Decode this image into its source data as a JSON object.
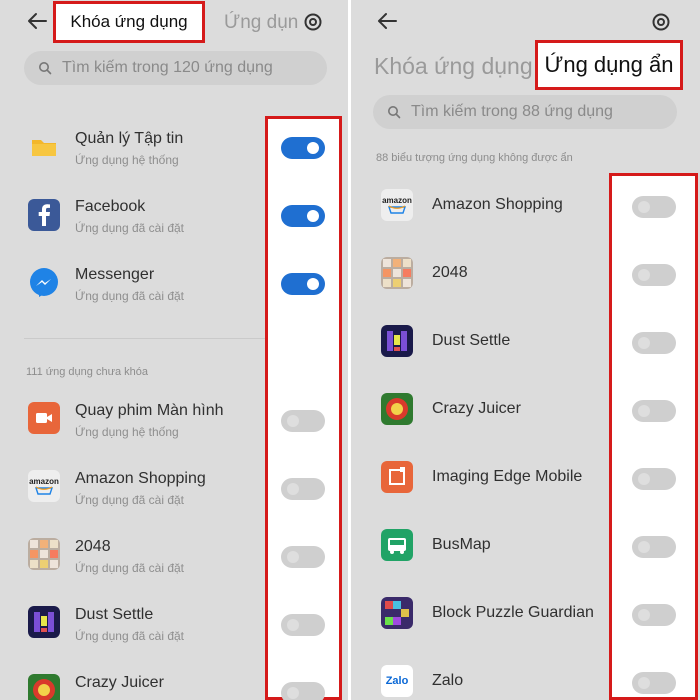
{
  "colors": {
    "accent": "#1f6fd1",
    "highlight": "#d51a1a",
    "background": "#dcdcdc"
  },
  "left": {
    "tab_active": "Khóa ứng dụng",
    "tab_inactive": "Ứng dụn",
    "search_placeholder": "Tìm kiếm trong 120 ứng dụng",
    "section_label": "111 ứng dụng chưa khóa",
    "locked": [
      {
        "name": "Quản lý Tập tin",
        "sub": "Ứng dụng hệ thống",
        "icon": "folder-icon",
        "on": true
      },
      {
        "name": "Facebook",
        "sub": "Ứng dụng đã cài đặt",
        "icon": "facebook-icon",
        "on": true
      },
      {
        "name": "Messenger",
        "sub": "Ứng dụng đã cài đặt",
        "icon": "messenger-icon",
        "on": true
      }
    ],
    "unlocked": [
      {
        "name": "Quay phim Màn hình",
        "sub": "Ứng dụng hệ thống",
        "icon": "screen-record-icon",
        "on": false
      },
      {
        "name": "Amazon Shopping",
        "sub": "Ứng dụng đã cài đặt",
        "icon": "amazon-icon",
        "on": false
      },
      {
        "name": "2048",
        "sub": "Ứng dụng đã cài đặt",
        "icon": "game-2048-icon",
        "on": false
      },
      {
        "name": "Dust Settle",
        "sub": "Ứng dụng đã cài đặt",
        "icon": "dust-settle-icon",
        "on": false
      },
      {
        "name": "Crazy Juicer",
        "sub": "",
        "icon": "crazy-juicer-icon",
        "on": false
      }
    ]
  },
  "right": {
    "tab_inactive": "Khóa ứng dụng",
    "tab_active": "Ứng dụng ẩn",
    "search_placeholder": "Tìm kiếm trong 88 ứng dụng",
    "section_label": "88 biểu tượng ứng dụng không được ẩn",
    "apps": [
      {
        "name": "Amazon Shopping",
        "icon": "amazon-icon",
        "on": false
      },
      {
        "name": "2048",
        "icon": "game-2048-icon",
        "on": false
      },
      {
        "name": "Dust Settle",
        "icon": "dust-settle-icon",
        "on": false
      },
      {
        "name": "Crazy Juicer",
        "icon": "crazy-juicer-icon",
        "on": false
      },
      {
        "name": "Imaging Edge Mobile",
        "icon": "imaging-edge-icon",
        "on": false
      },
      {
        "name": "BusMap",
        "icon": "busmap-icon",
        "on": false
      },
      {
        "name": "Block Puzzle Guardian",
        "icon": "block-puzzle-icon",
        "on": false
      },
      {
        "name": "Zalo",
        "icon": "zalo-icon",
        "on": false
      }
    ],
    "amazon_logo_text": "amazon",
    "zalo_logo_text": "Zalo"
  }
}
